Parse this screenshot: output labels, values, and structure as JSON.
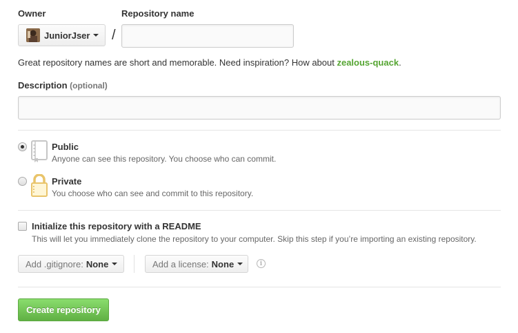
{
  "owner": {
    "label": "Owner",
    "selected": "JuniorJser"
  },
  "slash": "/",
  "repo_name": {
    "label": "Repository name",
    "value": ""
  },
  "hint": {
    "text": "Great repository names are short and memorable. Need inspiration? How about ",
    "suggestion": "zealous-quack",
    "end": "."
  },
  "description": {
    "label": "Description",
    "optional": "(optional)",
    "value": ""
  },
  "visibility": {
    "selected": "public",
    "public": {
      "title": "Public",
      "desc": "Anyone can see this repository. You choose who can commit.",
      "icon": "repo-book-icon"
    },
    "private": {
      "title": "Private",
      "desc": "You choose who can see and commit to this repository.",
      "icon": "lock-icon"
    }
  },
  "readme": {
    "checked": false,
    "title": "Initialize this repository with a README",
    "desc": "This will let you immediately clone the repository to your computer. Skip this step if you’re importing an existing repository."
  },
  "gitignore": {
    "label": "Add .gitignore:",
    "value": "None"
  },
  "license": {
    "label": "Add a license:",
    "value": "None"
  },
  "create_button": "Create repository",
  "colors": {
    "suggestion": "#55a532",
    "create_button": "#60b044",
    "lock": "#e9c46a"
  }
}
